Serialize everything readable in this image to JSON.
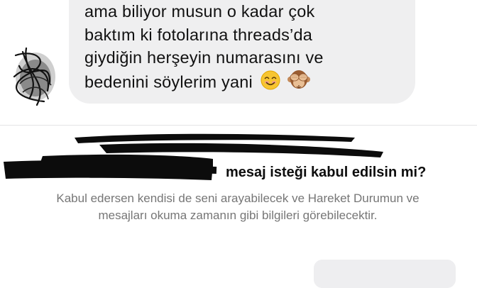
{
  "message": {
    "lines": [
      "ama biliyor musun o kadar çok",
      "baktım ki fotolarına threads’da",
      "giydiğin herşeyin numarasını ve",
      "bedenini söylerim yani"
    ],
    "emojis": [
      "smiling-face-icon",
      "see-no-evil-monkey-icon"
    ]
  },
  "request": {
    "title": "mesaj isteği kabul edilsin mi?",
    "body": "Kabul edersen kendisi de seni arayabilecek ve Hareket Durumun ve mesajları okuma zamanın gibi bilgileri görebilecektir."
  },
  "colors": {
    "bubble": "#efeff0",
    "body_text": "#767676",
    "title_text": "#0d0d0d"
  }
}
